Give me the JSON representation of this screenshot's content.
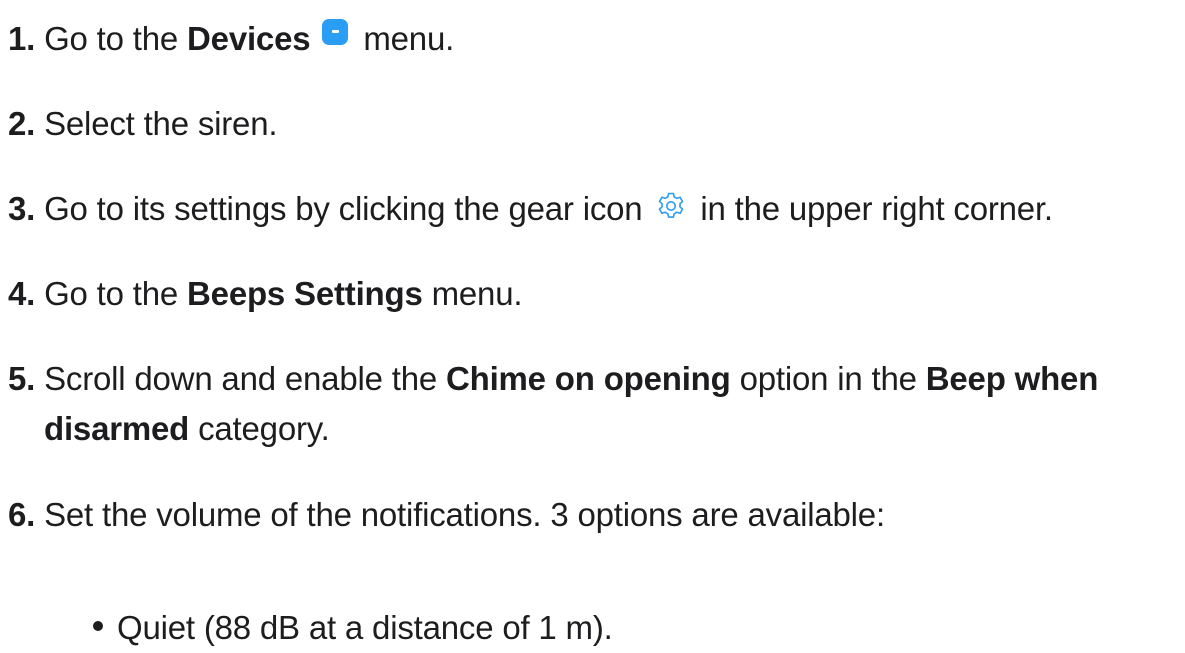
{
  "steps": [
    {
      "num": "1.",
      "parts": [
        "Go to the ",
        "Devices",
        " menu."
      ]
    },
    {
      "num": "2.",
      "parts": [
        "Select the siren."
      ]
    },
    {
      "num": "3.",
      "parts": [
        "Go to its settings by clicking the gear icon ",
        " in the upper right corner."
      ]
    },
    {
      "num": "4.",
      "parts": [
        "Go to the ",
        "Beeps Settings",
        " menu."
      ]
    },
    {
      "num": "5.",
      "parts": [
        "Scroll down and enable the ",
        "Chime on opening",
        " option in the ",
        "Beep when"
      ],
      "line2": [
        "disarmed",
        " category."
      ]
    },
    {
      "num": "6.",
      "parts": [
        "Set the volume of the notifications. 3 options are available:"
      ]
    }
  ],
  "bullets": [
    "Quiet (88 dB at a distance of 1 m)."
  ],
  "icons": {
    "devices": "devices-icon",
    "gear": "gear-icon",
    "accent": "#2a9df4"
  }
}
